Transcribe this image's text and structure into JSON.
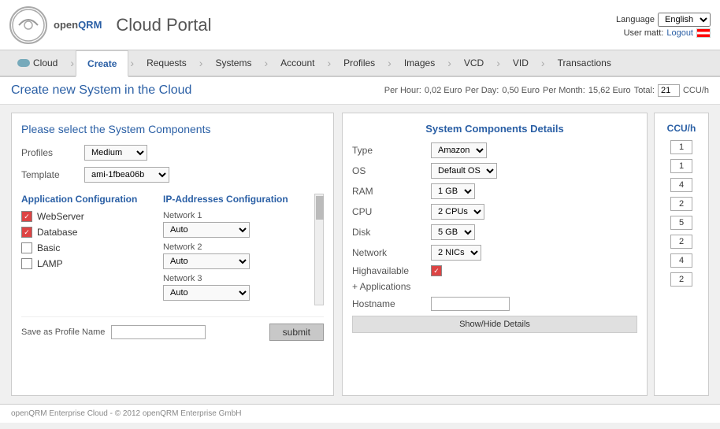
{
  "header": {
    "app_title": "Cloud Portal",
    "language_label": "Language",
    "language_value": "English",
    "user_label": "User matt:",
    "logout_label": "Logout"
  },
  "nav": {
    "items": [
      {
        "id": "cloud",
        "label": "Cloud",
        "active": false,
        "has_icon": true
      },
      {
        "id": "create",
        "label": "Create",
        "active": true
      },
      {
        "id": "requests",
        "label": "Requests",
        "active": false
      },
      {
        "id": "systems",
        "label": "Systems",
        "active": false
      },
      {
        "id": "account",
        "label": "Account",
        "active": false
      },
      {
        "id": "profiles",
        "label": "Profiles",
        "active": false
      },
      {
        "id": "images",
        "label": "Images",
        "active": false
      },
      {
        "id": "vcd",
        "label": "VCD",
        "active": false
      },
      {
        "id": "vid",
        "label": "VID",
        "active": false
      },
      {
        "id": "transactions",
        "label": "Transactions",
        "active": false
      }
    ]
  },
  "page": {
    "title": "Create new System in the Cloud",
    "cost": {
      "per_hour_label": "Per Hour:",
      "per_hour_value": "0,02 Euro",
      "per_day_label": "Per Day:",
      "per_day_value": "0,50 Euro",
      "per_month_label": "Per Month:",
      "per_month_value": "15,62 Euro",
      "total_label": "Total:",
      "total_value": "21",
      "unit": "CCU/h"
    }
  },
  "left_panel": {
    "title": "Please select the System Components",
    "profiles_label": "Profiles",
    "profiles_value": "Medium",
    "template_label": "Template",
    "template_value": "ami-1fbea06b",
    "app_config": {
      "title": "Application Configuration",
      "items": [
        {
          "label": "WebServer",
          "checked": true
        },
        {
          "label": "Database",
          "checked": true
        },
        {
          "label": "Basic",
          "checked": false
        },
        {
          "label": "LAMP",
          "checked": false
        }
      ]
    },
    "ip_config": {
      "title": "IP-Addresses Configuration",
      "networks": [
        {
          "label": "Network 1",
          "value": "Auto"
        },
        {
          "label": "Network 2",
          "value": "Auto"
        },
        {
          "label": "Network 3",
          "value": "Auto"
        }
      ]
    },
    "save_label": "Save as Profile Name",
    "submit_label": "submit"
  },
  "right_panel": {
    "details_title": "System Components Details",
    "ccu_title": "CCU/h",
    "fields": [
      {
        "label": "Type",
        "value": "Amazon",
        "type": "select"
      },
      {
        "label": "OS",
        "value": "Default OS",
        "type": "select"
      },
      {
        "label": "RAM",
        "value": "1 GB",
        "type": "select"
      },
      {
        "label": "CPU",
        "value": "2 CPUs",
        "type": "select"
      },
      {
        "label": "Disk",
        "value": "5 GB",
        "type": "select"
      },
      {
        "label": "Network",
        "value": "2 NICs",
        "type": "select"
      },
      {
        "label": "Highavailable",
        "value": "checked",
        "type": "checkbox"
      },
      {
        "label": "+ Applications",
        "value": "",
        "type": "label"
      },
      {
        "label": "Hostname",
        "value": "",
        "type": "input"
      }
    ],
    "ccu_values": [
      "1",
      "1",
      "4",
      "2",
      "5",
      "2",
      "4",
      "2"
    ],
    "show_hide_label": "Show/Hide Details"
  },
  "footer": {
    "text": "openQRM Enterprise Cloud - © 2012 openQRM Enterprise GmbH"
  }
}
